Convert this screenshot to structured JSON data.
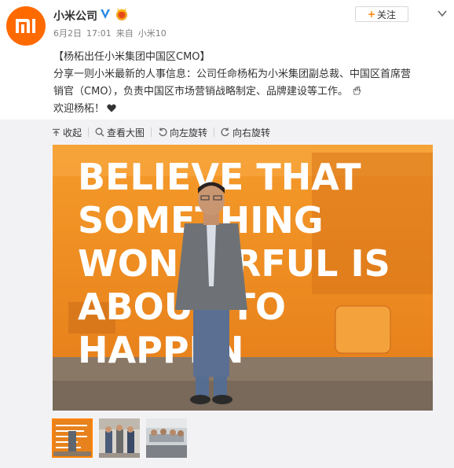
{
  "post": {
    "account_name": "小米公司",
    "avatar_logo_text": "mi",
    "follow_label": "关注",
    "date": "6月2日",
    "time": "17:01",
    "source_prefix": "来自",
    "source_device": "小米10",
    "content": {
      "line1": "【杨柘出任小米集团中国区CMO】",
      "line2": "分享一则小米最新的人事信息：公司任命杨柘为小米集团副总裁、中国区首席营",
      "line3": "销官（CMO），负责中国区市场营销战略制定、品牌建设等工作。",
      "line4": "欢迎杨柘！"
    }
  },
  "toolbar": {
    "collapse": "收起",
    "view_large": "查看大图",
    "rotate_left": "向左旋转",
    "rotate_right": "向右旋转"
  },
  "photo": {
    "wall_text": [
      "BELIEVE THAT",
      "SOMETHING",
      "WONDERFUL IS",
      "ABOUT TO",
      "HAPPEN"
    ]
  },
  "colors": {
    "brand_orange": "#ff6a00",
    "glass_orange": "#f08a1c",
    "link_orange": "#ff8200",
    "verified_blue": "#2a8ae8"
  }
}
